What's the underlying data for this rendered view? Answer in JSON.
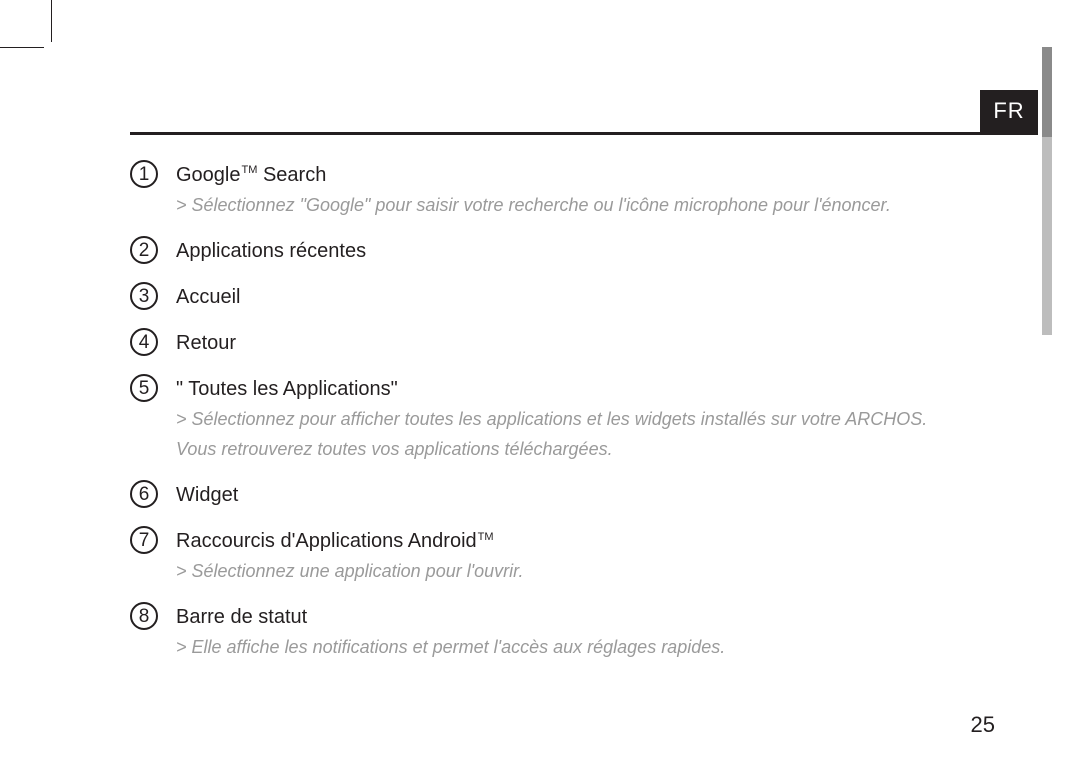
{
  "language_tab": "FR",
  "page_number": "25",
  "items": [
    {
      "num": "1",
      "title_pre": "Google",
      "title_tm": "TM",
      "title_post": " Search",
      "subs": [
        "> Sélectionnez \"Google\" pour saisir votre recherche ou l'icône microphone pour l'énoncer."
      ]
    },
    {
      "num": "2",
      "title_pre": "Applications récentes",
      "title_tm": "",
      "title_post": "",
      "subs": []
    },
    {
      "num": "3",
      "title_pre": "Accueil",
      "title_tm": "",
      "title_post": "",
      "subs": []
    },
    {
      "num": "4",
      "title_pre": "Retour",
      "title_tm": "",
      "title_post": "",
      "subs": []
    },
    {
      "num": "5",
      "title_pre": " \" Toutes les Applications\"",
      "title_tm": "",
      "title_post": "",
      "subs": [
        "> Sélectionnez pour afficher toutes les applications et les widgets installés sur votre ARCHOS.",
        "Vous retrouverez toutes vos applications téléchargées."
      ]
    },
    {
      "num": "6",
      "title_pre": "Widget",
      "title_tm": "",
      "title_post": "",
      "subs": []
    },
    {
      "num": "7",
      "title_pre": "Raccourcis d'Applications Android",
      "title_tm": "TM",
      "title_post": "",
      "subs": [
        "> Sélectionnez une application pour l'ouvrir."
      ]
    },
    {
      "num": "8",
      "title_pre": "Barre de statut",
      "title_tm": "",
      "title_post": "",
      "subs": [
        "> Elle affiche les notifications et permet l'accès aux réglages rapides."
      ]
    }
  ]
}
